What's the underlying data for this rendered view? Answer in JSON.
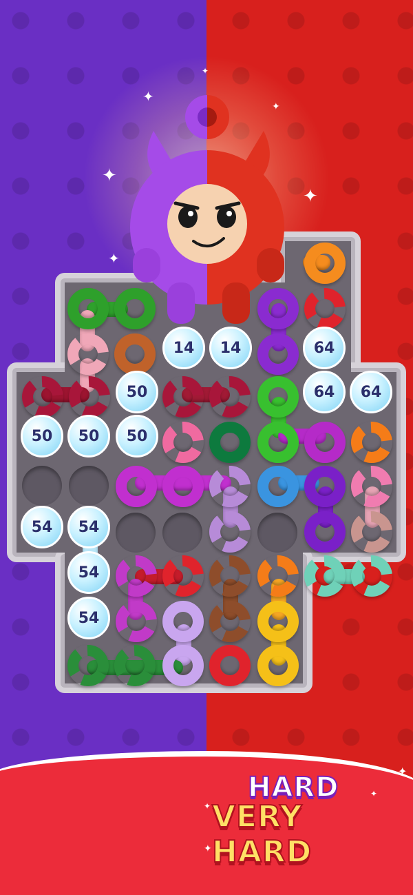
{
  "colors": {
    "left_bg": "#6a2fc4",
    "right_bg": "#d8201d",
    "board": "#b9b4bd",
    "board_border": "#d6d2d9",
    "footer": "#ec2c3a",
    "hard_text": "#ffffff",
    "very_hard_text": "#ffe066"
  },
  "icons": {
    "mascot": "devil-mascot-icon",
    "sparkle": "sparkle-icon"
  },
  "ice_tiles": [
    {
      "label": "14"
    },
    {
      "label": "14"
    },
    {
      "label": "64"
    },
    {
      "label": "50"
    },
    {
      "label": "64"
    },
    {
      "label": "64"
    },
    {
      "label": "50"
    },
    {
      "label": "50"
    },
    {
      "label": "50"
    },
    {
      "label": "54"
    },
    {
      "label": "54"
    },
    {
      "label": "54"
    },
    {
      "label": "54"
    }
  ],
  "footer": {
    "difficulty_label": "HARD",
    "difficulty_sublabel": "VERY HARD"
  }
}
